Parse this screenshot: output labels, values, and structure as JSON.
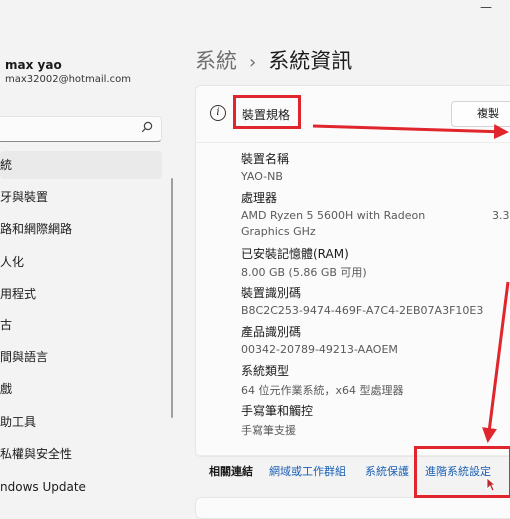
{
  "window": {
    "minimize_glyph": "—"
  },
  "user": {
    "name": "max yao",
    "email": "max32002@hotmail.com"
  },
  "search": {
    "icon": "search-icon"
  },
  "sidebar": {
    "items": [
      {
        "label": "統",
        "selected": true
      },
      {
        "label": "牙與裝置"
      },
      {
        "label": "路和網際網路"
      },
      {
        "label": "人化"
      },
      {
        "label": "用程式"
      },
      {
        "label": "古"
      },
      {
        "label": "間與語言"
      },
      {
        "label": "戲"
      },
      {
        "label": "助工具"
      },
      {
        "label": "私權與安全性"
      },
      {
        "label": "ndows Update"
      }
    ]
  },
  "breadcrumb": {
    "parent": "系統",
    "separator": "›",
    "current": "系統資訊"
  },
  "device_specs": {
    "title": "裝置規格",
    "copy_label": "複製",
    "device_name_label": "裝置名稱",
    "device_name": "YAO-NB",
    "processor_label": "處理器",
    "processor": "AMD Ryzen 5 5600H with Radeon Graphics GHz",
    "processor_speed": "3.30",
    "ram_label": "已安裝記憶體(RAM)",
    "ram": "8.00 GB (5.86 GB 可用)",
    "device_id_label": "裝置識別碼",
    "device_id": "B8C2C253-9474-469F-A7C4-2EB07A3F10E3",
    "product_id_label": "產品識別碼",
    "product_id": "00342-20789-49213-AAOEM",
    "system_type_label": "系統類型",
    "system_type": "64 位元作業系統，x64 型處理器",
    "pen_touch_label": "手寫筆和觸控",
    "pen_touch": "手寫筆支援"
  },
  "related": {
    "label": "相關連結",
    "links": [
      "網域或工作群組",
      "系統保護",
      "進階系統設定"
    ]
  },
  "colors": {
    "annotation_red": "#e0262c",
    "link_blue": "#1a5fb4",
    "background": "#f3f3f3"
  }
}
